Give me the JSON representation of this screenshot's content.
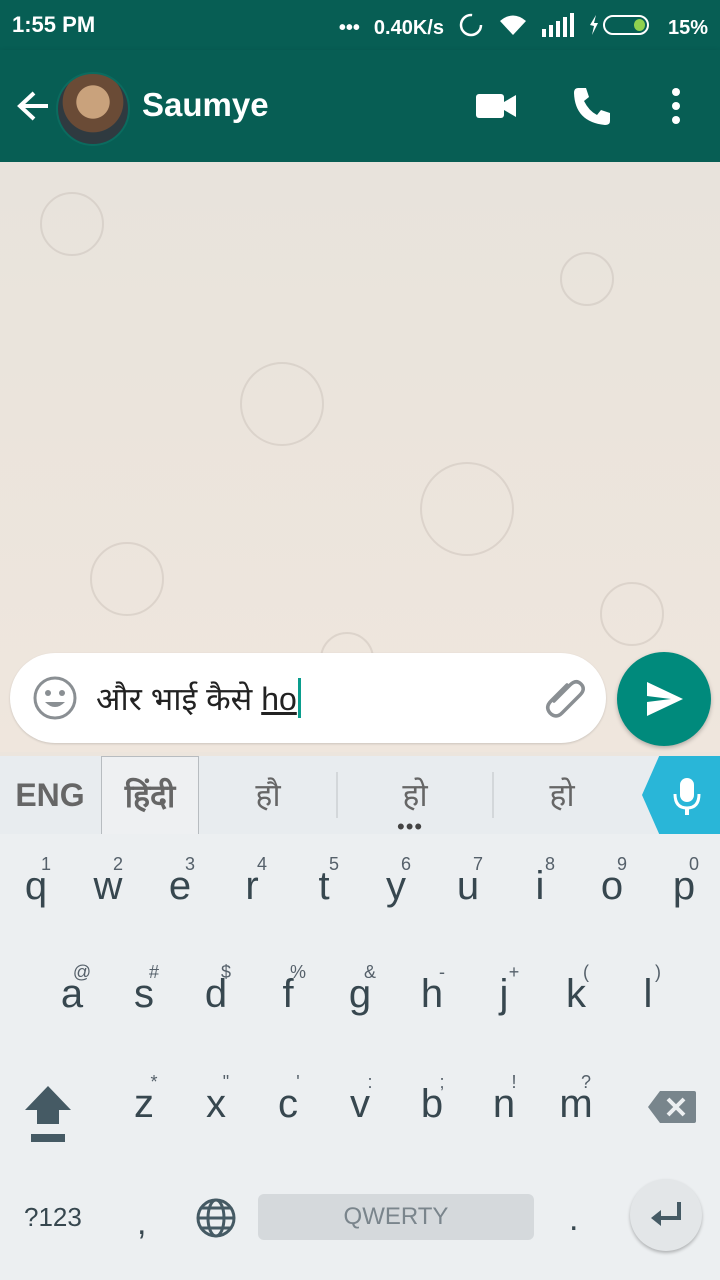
{
  "status_bar": {
    "time": "1:55 PM",
    "network_speed": "0.40K/s",
    "battery": "15%"
  },
  "header": {
    "contact_name": "Saumye",
    "icons": [
      "back-arrow-icon",
      "video-call-icon",
      "phone-icon",
      "more-vert-icon"
    ]
  },
  "composer": {
    "text_committed": "और भाई कैसे ",
    "text_composing": "ho",
    "icons": [
      "emoji-icon",
      "attach-icon",
      "send-icon"
    ]
  },
  "suggestions": {
    "lang_eng": "ENG",
    "lang_hindi": "हिंदी",
    "items": [
      "हौ",
      "हो",
      "हो"
    ],
    "more_indicator": "•••"
  },
  "keyboard": {
    "row1": [
      {
        "key": "q",
        "hint": "1"
      },
      {
        "key": "w",
        "hint": "2"
      },
      {
        "key": "e",
        "hint": "3"
      },
      {
        "key": "r",
        "hint": "4"
      },
      {
        "key": "t",
        "hint": "5"
      },
      {
        "key": "y",
        "hint": "6"
      },
      {
        "key": "u",
        "hint": "7"
      },
      {
        "key": "i",
        "hint": "8"
      },
      {
        "key": "o",
        "hint": "9"
      },
      {
        "key": "p",
        "hint": "0"
      }
    ],
    "row2": [
      {
        "key": "a",
        "hint": "@"
      },
      {
        "key": "s",
        "hint": "#"
      },
      {
        "key": "d",
        "hint": "$"
      },
      {
        "key": "f",
        "hint": "%"
      },
      {
        "key": "g",
        "hint": "&"
      },
      {
        "key": "h",
        "hint": "-"
      },
      {
        "key": "j",
        "hint": "+"
      },
      {
        "key": "k",
        "hint": "("
      },
      {
        "key": "l",
        "hint": ")"
      }
    ],
    "row3": [
      {
        "key": "z",
        "hint": "*"
      },
      {
        "key": "x",
        "hint": "\""
      },
      {
        "key": "c",
        "hint": "'"
      },
      {
        "key": "v",
        "hint": ":"
      },
      {
        "key": "b",
        "hint": ";"
      },
      {
        "key": "n",
        "hint": "!"
      },
      {
        "key": "m",
        "hint": "?"
      }
    ],
    "symbols_key": "?123",
    "comma_key": ",",
    "space_label": "QWERTY",
    "period_key": "."
  },
  "colors": {
    "header_bg": "#075e54",
    "send_button": "#008a7c",
    "mic_bg": "#29b6d8"
  }
}
